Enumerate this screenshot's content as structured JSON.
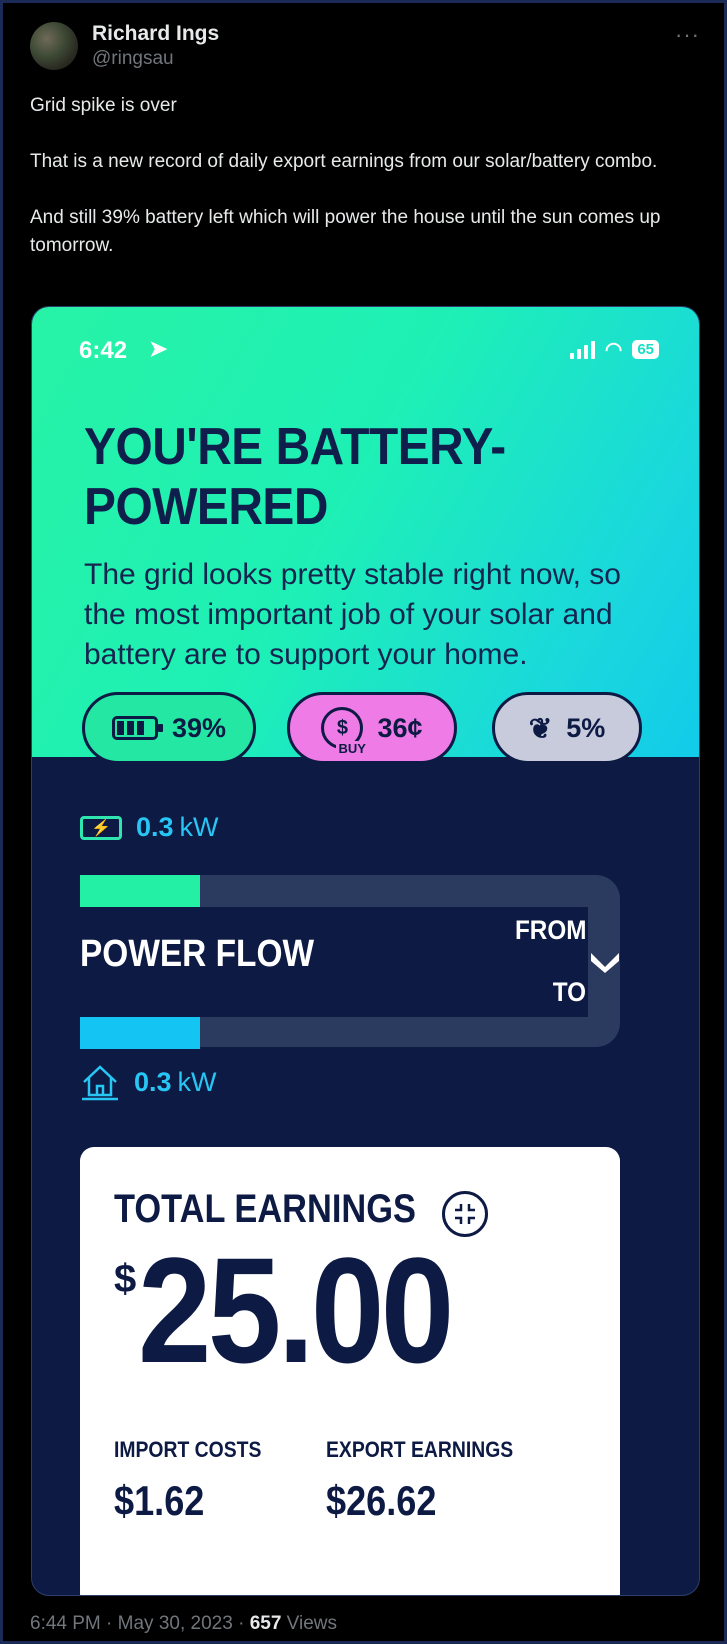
{
  "tweet": {
    "author_name": "Richard Ings",
    "author_handle": "@ringsau",
    "more": "···",
    "paragraphs": [
      "Grid spike is over",
      "That is a new record of daily export earnings from our solar/battery combo.",
      "And still 39% battery left which will power the house until the sun comes up tomorrow."
    ],
    "footer": {
      "time": "6:44 PM",
      "date": "May 30, 2023",
      "sep": "·",
      "views": "657",
      "views_label": "Views"
    }
  },
  "app": {
    "status_bar": {
      "time": "6:42",
      "battery": "65"
    },
    "hero": {
      "title_line1": "YOU'RE BATTERY-",
      "title_line2": "POWERED",
      "subtitle": "The grid looks pretty stable right now, so the most important job of your solar and battery are to support your home."
    },
    "pills": {
      "battery": "39%",
      "buy_price": "36¢",
      "buy_tag": "BUY",
      "renewable": "5%"
    },
    "power_flow": {
      "top_value": "0.3",
      "top_unit": "kW",
      "bottom_value": "0.3",
      "bottom_unit": "kW",
      "title": "POWER FLOW",
      "from_label": "FROM",
      "to_label": "TO"
    },
    "earnings": {
      "title": "TOTAL EARNINGS",
      "currency": "$",
      "amount": "25.00",
      "import_label": "IMPORT COSTS",
      "import_value": "$1.62",
      "export_label": "EXPORT EARNINGS",
      "export_value": "$26.62"
    },
    "colors": {
      "hero_start": "#27f3a6",
      "hero_end": "#12cbea",
      "navy": "#0d1a44",
      "buy_pink": "#ee7be6",
      "accent_blue": "#27c6f4"
    }
  }
}
